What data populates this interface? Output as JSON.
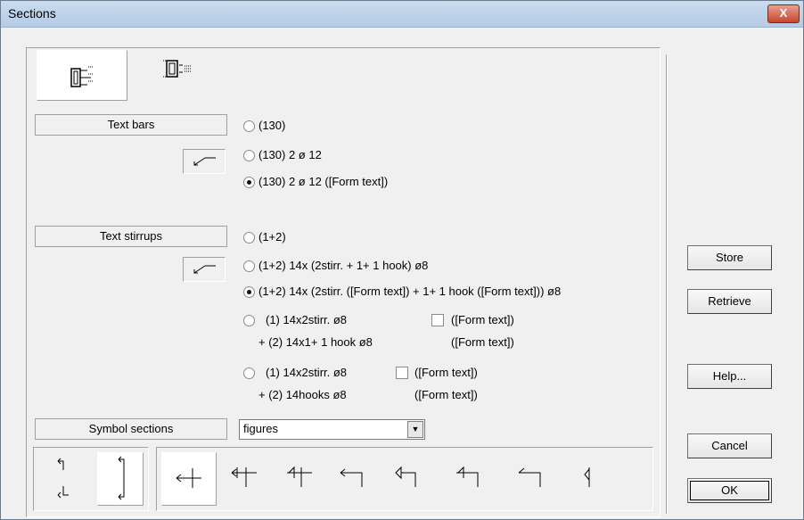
{
  "window": {
    "title": "Sections",
    "close_label": "X"
  },
  "bars": {
    "label": "Text bars",
    "options": [
      "(130)",
      "(130) 2 ø 12",
      "(130) 2 ø 12 ([Form text])"
    ],
    "selected_index": 2
  },
  "stirrups": {
    "label": "Text stirrups",
    "option1": "(1+2)",
    "option2": "(1+2) 14x (2stirr. + 1+ 1 hook) ø8",
    "option3": "(1+2) 14x (2stirr. ([Form text]) + 1+ 1 hook ([Form text])) ø8",
    "option4_line1": "(1) 14x2stirr. ø8",
    "option4_line2": "+ (2) 14x1+ 1 hook ø8",
    "option4_form1": "([Form text])",
    "option4_form2": "([Form text])",
    "option5_line1": "(1) 14x2stirr. ø8",
    "option5_line2": "+ (2) 14hooks ø8",
    "option5_form1": "([Form text])",
    "option5_form2": "([Form text])",
    "selected_index": 2
  },
  "symbol": {
    "label": "Symbol sections",
    "value": "figures"
  },
  "buttons": {
    "store": "Store",
    "retrieve": "Retrieve",
    "help": "Help...",
    "cancel": "Cancel",
    "ok": "OK"
  },
  "icons": [
    "section-with-bars-icon",
    "section-with-stirrups-icon",
    "leader-arrow-icon",
    "section-arrows-vertical-icon",
    "section-arrows-bracket-icon",
    "section-symbol-1-icon",
    "section-symbol-2-icon",
    "section-symbol-3-icon",
    "section-symbol-4-icon",
    "section-symbol-5-icon",
    "section-symbol-6-icon",
    "section-symbol-7-icon",
    "section-symbol-8-icon"
  ]
}
